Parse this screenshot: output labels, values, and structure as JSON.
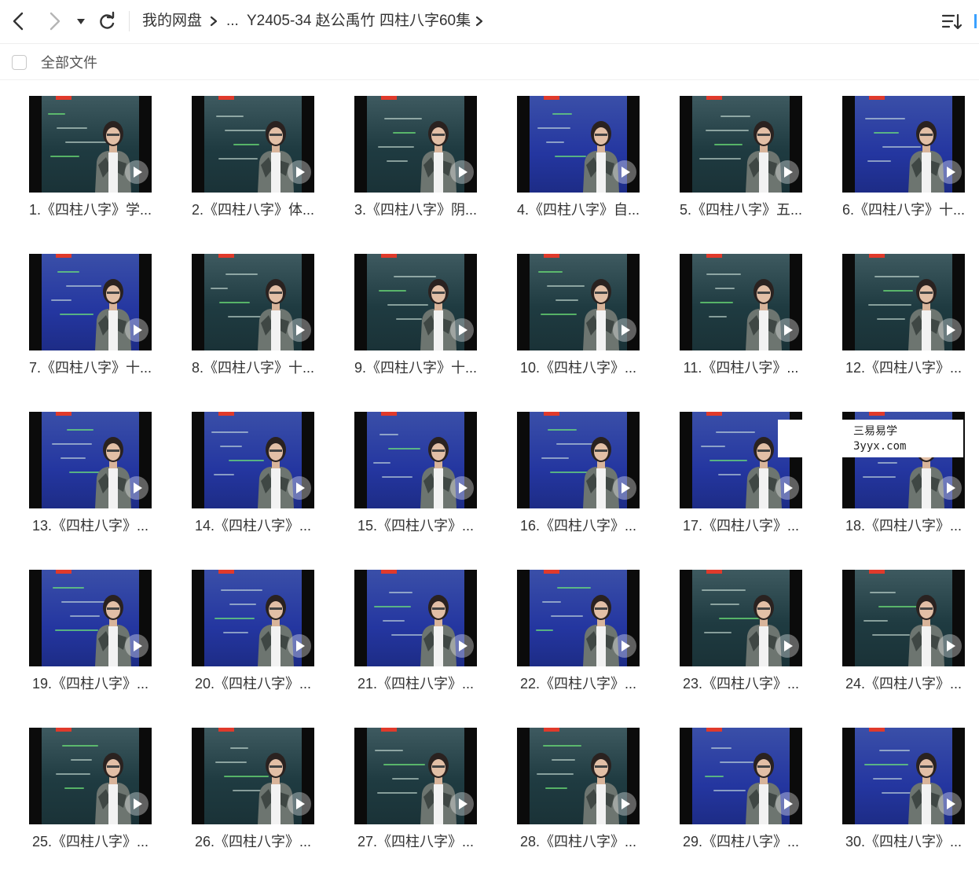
{
  "toolbar": {
    "breadcrumb_root": "我的网盘",
    "breadcrumb_ellipsis": "...",
    "breadcrumb_current": "Y2405-34 赵公禹竹 四柱八字60集",
    "sort_icon": "sort-descending-icon"
  },
  "selection": {
    "all_files_label": "全部文件"
  },
  "files": [
    {
      "caption": "1.《四柱八字》学...",
      "screen": "dark"
    },
    {
      "caption": "2.《四柱八字》体...",
      "screen": "dark"
    },
    {
      "caption": "3.《四柱八字》阴...",
      "screen": "dark"
    },
    {
      "caption": "4.《四柱八字》自...",
      "screen": "blue"
    },
    {
      "caption": "5.《四柱八字》五...",
      "screen": "dark"
    },
    {
      "caption": "6.《四柱八字》十...",
      "screen": "blue"
    },
    {
      "caption": "7.《四柱八字》十...",
      "screen": "blue"
    },
    {
      "caption": "8.《四柱八字》十...",
      "screen": "dark"
    },
    {
      "caption": "9.《四柱八字》十...",
      "screen": "dark"
    },
    {
      "caption": "10.《四柱八字》...",
      "screen": "dark"
    },
    {
      "caption": "11.《四柱八字》...",
      "screen": "dark"
    },
    {
      "caption": "12.《四柱八字》...",
      "screen": "dark"
    },
    {
      "caption": "13.《四柱八字》...",
      "screen": "blue"
    },
    {
      "caption": "14.《四柱八字》...",
      "screen": "blue"
    },
    {
      "caption": "15.《四柱八字》...",
      "screen": "blue"
    },
    {
      "caption": "16.《四柱八字》...",
      "screen": "blue"
    },
    {
      "caption": "17.《四柱八字》...",
      "screen": "blue"
    },
    {
      "caption": "18.《四柱八字》...",
      "screen": "blue"
    },
    {
      "caption": "19.《四柱八字》...",
      "screen": "blue"
    },
    {
      "caption": "20.《四柱八字》...",
      "screen": "blue"
    },
    {
      "caption": "21.《四柱八字》...",
      "screen": "blue"
    },
    {
      "caption": "22.《四柱八字》...",
      "screen": "blue"
    },
    {
      "caption": "23.《四柱八字》...",
      "screen": "dark"
    },
    {
      "caption": "24.《四柱八字》...",
      "screen": "dark"
    },
    {
      "caption": "25.《四柱八字》...",
      "screen": "dark"
    },
    {
      "caption": "26.《四柱八字》...",
      "screen": "dark"
    },
    {
      "caption": "27.《四柱八字》...",
      "screen": "dark"
    },
    {
      "caption": "28.《四柱八字》...",
      "screen": "dark"
    },
    {
      "caption": "29.《四柱八字》...",
      "screen": "blue"
    },
    {
      "caption": "30.《四柱八字》...",
      "screen": "blue"
    }
  ],
  "watermark": {
    "line1": "三易易学",
    "line2": "3yyx.com"
  },
  "colors": {
    "accent": "#3aa1ff",
    "brand_red": "#e03a2b"
  }
}
